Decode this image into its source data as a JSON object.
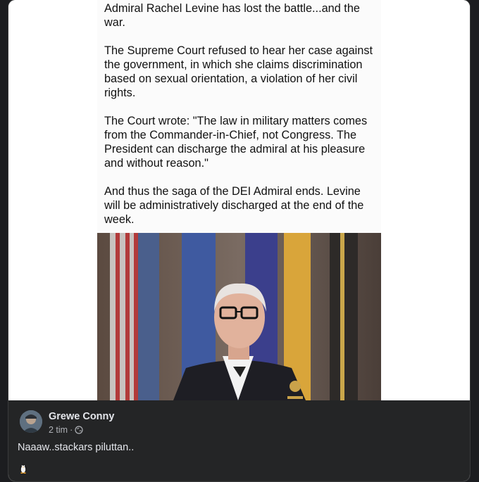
{
  "post": {
    "paragraphs": [
      "Admiral Rachel Levine has lost the battle...and the war.",
      "The Supreme Court refused to hear her case against the government, in which she claims discrimination based on sexual orientation, a violation of her civil rights.",
      "The Court wrote: \"The law in military matters comes from the Commander-in-Chief, not Congress. The President can discharge the admiral at his pleasure and without reason.\"",
      "And thus the saga of the DEI Admiral ends. Levine will be administratively discharged at the end of the week."
    ]
  },
  "footer": {
    "author": "Grewe Conny",
    "time": "2 tim",
    "separator": "·",
    "comment": "Naaaw..stackars piluttan..",
    "privacy_icon": "globe-icon",
    "reaction_icon": "penguin-emoji"
  },
  "colors": {
    "footer_bg": "#242526",
    "author_text": "#e4e6eb",
    "meta_text": "#b0b3b8"
  }
}
